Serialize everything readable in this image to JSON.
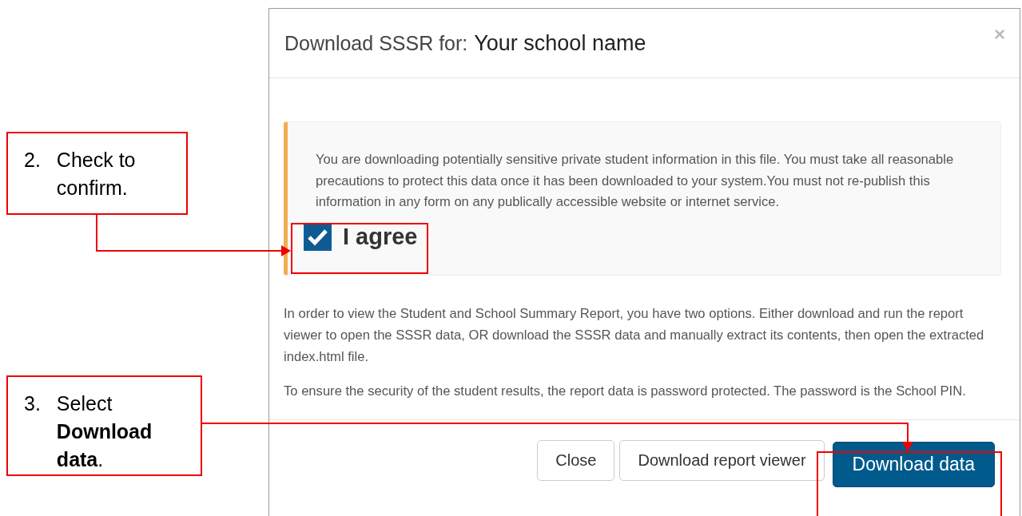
{
  "dialog": {
    "title": "Download SSSR for:",
    "school": "Your school name",
    "close": "×",
    "warning": "You are downloading potentially sensitive private student information in this file. You must take all reasonable precautions to protect this data once it has been downloaded to your system.You must not re-publish this information in any form on any publically accessible website or internet service.",
    "agree": {
      "label": "I agree",
      "checked": true
    },
    "paragraphs": [
      "In order to view the Student and School Summary Report, you have two options. Either download and run the report viewer to open the SSSR data, OR download the SSSR data and manually extract its contents, then open the extracted index.html file.",
      "To ensure the security of the student results, the report data is password protected. The password is the School PIN."
    ],
    "buttons": [
      {
        "label": "Close",
        "kind": "default"
      },
      {
        "label": "Download report viewer",
        "kind": "default"
      },
      {
        "label": "Download data",
        "kind": "primary"
      }
    ]
  },
  "callouts": [
    {
      "number": "2.",
      "text": "Check to confirm."
    },
    {
      "number": "3.",
      "text": "Select **Download data**."
    }
  ]
}
